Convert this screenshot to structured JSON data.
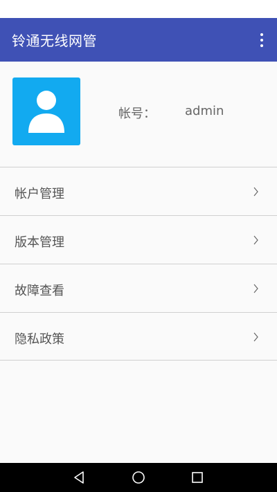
{
  "app_bar": {
    "title": "铃通无线网管",
    "menu_icon": "more-vert-icon"
  },
  "profile": {
    "avatar_icon": "user-avatar-icon",
    "avatar_color": "#12aaf0",
    "account_label": "帐号：",
    "account_value": "admin"
  },
  "menu": {
    "items": [
      {
        "label": "帐户管理",
        "icon": "chevron-right-icon"
      },
      {
        "label": "版本管理",
        "icon": "chevron-right-icon"
      },
      {
        "label": "故障查看",
        "icon": "chevron-right-icon"
      },
      {
        "label": "隐私政策",
        "icon": "chevron-right-icon"
      }
    ]
  },
  "navigation": {
    "back_icon": "back-icon",
    "home_icon": "home-icon",
    "recents_icon": "recents-icon"
  },
  "colors": {
    "primary": "#3f51b5",
    "background": "#fafafa",
    "text": "#555555",
    "divider": "#cfcfcf"
  }
}
